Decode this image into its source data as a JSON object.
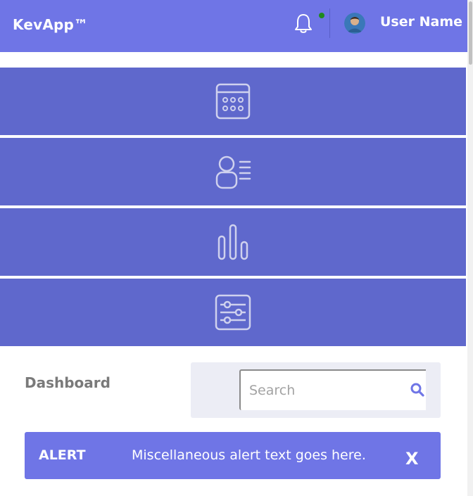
{
  "header": {
    "brand": "KevApp™",
    "user_name": "User Name",
    "notification_indicator_color": "#1f8a1f"
  },
  "nav": {
    "items": [
      {
        "icon": "calendar-icon"
      },
      {
        "icon": "user-list-icon"
      },
      {
        "icon": "bar-chart-icon"
      },
      {
        "icon": "sliders-icon"
      }
    ]
  },
  "main": {
    "title": "Dashboard",
    "search": {
      "placeholder": "Search",
      "value": ""
    }
  },
  "alert": {
    "label": "ALERT",
    "text": "Miscellaneous alert text goes here.",
    "close_label": "X"
  },
  "colors": {
    "header_bg": "#6f75e6",
    "nav_tile_bg": "#5f68cc",
    "alert_bg": "#6f75e6",
    "search_panel_bg": "#ecedf5"
  }
}
